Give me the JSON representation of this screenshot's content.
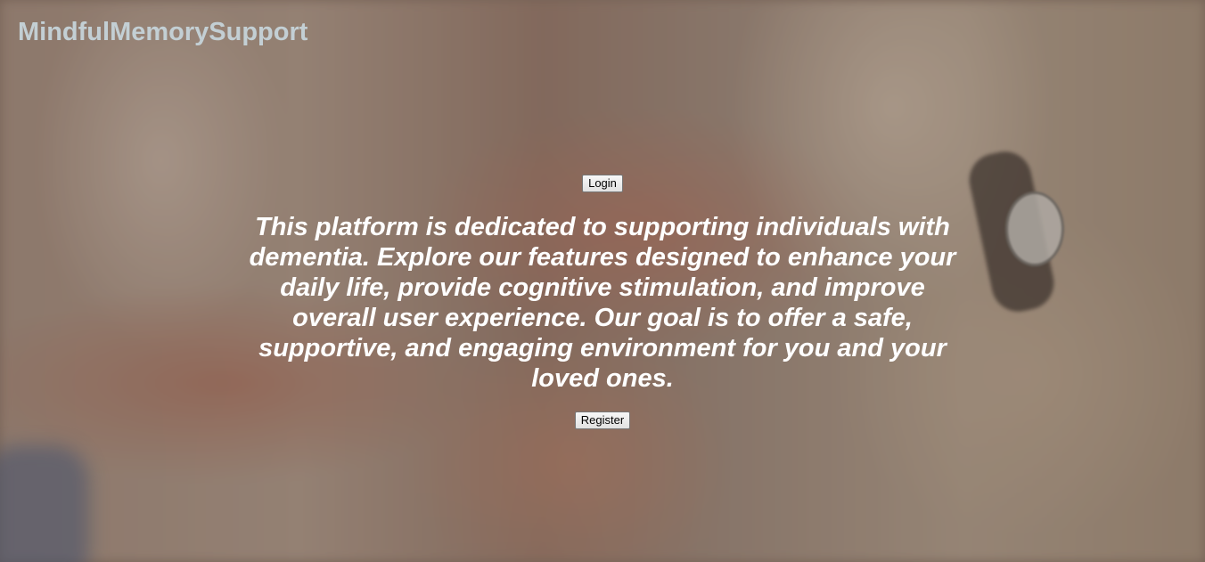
{
  "brand": {
    "name": "MindfulMemorySupport"
  },
  "actions": {
    "login_label": "Login",
    "register_label": "Register"
  },
  "hero": {
    "message": "This platform is dedicated to supporting individuals with dementia. Explore our features designed to enhance your daily life, provide cognitive stimulation, and improve overall user experience. Our goal is to offer a safe, supportive, and engaging environment for you and your loved ones."
  },
  "colors": {
    "brand_text": "#c3cfd4",
    "message_text": "#ffffff"
  }
}
